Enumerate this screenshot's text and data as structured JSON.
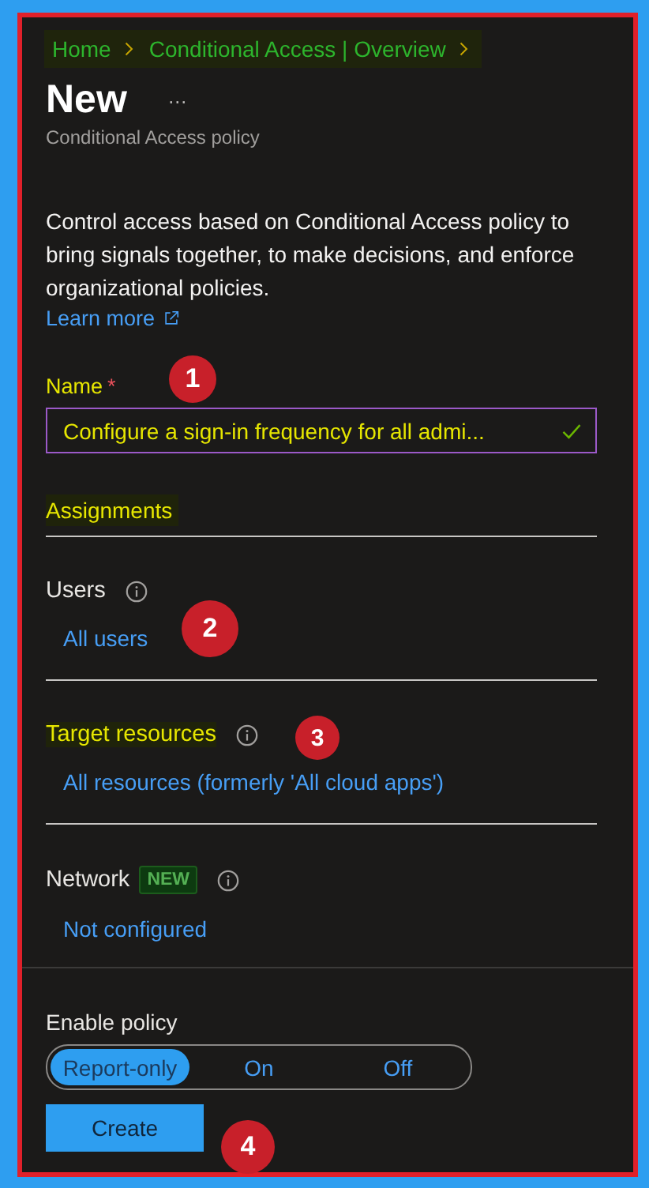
{
  "breadcrumb": [
    "Home",
    "Conditional Access | Overview"
  ],
  "title": "New",
  "more": "···",
  "subtitle": "Conditional Access policy",
  "description": "Control access based on Conditional Access policy to bring signals together, to make decisions, and enforce organizational policies.",
  "learn_more": "Learn more",
  "name_field": {
    "label": "Name",
    "required_mark": "*",
    "value": "Configure a sign-in frequency for all admi...",
    "valid": true
  },
  "assignments_heading": "Assignments",
  "assignments": [
    {
      "label": "Users",
      "value": "All users",
      "highlighted": false
    },
    {
      "label": "Target resources",
      "value": "All resources (formerly 'All cloud apps')",
      "highlighted": true
    },
    {
      "label": "Network",
      "badge": "NEW",
      "value": "Not configured",
      "highlighted": false
    }
  ],
  "enable_policy": {
    "label": "Enable policy",
    "options": [
      {
        "label": "Report-only",
        "selected": true
      },
      {
        "label": "On",
        "selected": false
      },
      {
        "label": "Off",
        "selected": false
      }
    ]
  },
  "create_button": "Create",
  "callouts": [
    "1",
    "2",
    "3",
    "4"
  ]
}
